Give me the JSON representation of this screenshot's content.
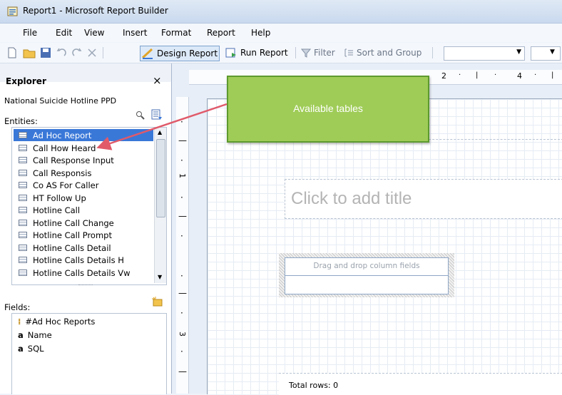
{
  "window": {
    "title": "Report1 - Microsoft Report Builder"
  },
  "menu": [
    "File",
    "Edit",
    "View",
    "Insert",
    "Format",
    "Report",
    "Help"
  ],
  "toolbar": {
    "design_report": "Design Report",
    "run_report": "Run Report",
    "filter": "Filter",
    "sort_group": "Sort and Group"
  },
  "explorer": {
    "title": "Explorer",
    "close": "×",
    "model": "National Suicide Hotline PPD",
    "entities_label": "Entities:",
    "entities": [
      "Ad Hoc Report",
      "Call How Heard",
      "Call Response Input",
      "Call Responsis",
      "Co AS For Caller",
      "HT Follow Up",
      "Hotline Call",
      "Hotline Call Change",
      "Hotline Call Prompt",
      "Hotline Calls Detail",
      "Hotline Calls Details H",
      "Hotline Calls Details Vw"
    ],
    "selected_entity_index": 0,
    "fields_label": "Fields:",
    "fields": [
      {
        "icon": "aggregate-icon",
        "label": "#Ad Hoc Reports"
      },
      {
        "icon": "text-field-icon",
        "label": "Name"
      },
      {
        "icon": "text-field-icon",
        "label": "SQL"
      }
    ]
  },
  "ruler": {
    "h_marks": [
      "2",
      "4"
    ],
    "v_marks": [
      "1",
      "3"
    ]
  },
  "design": {
    "title_placeholder": "Click to add title",
    "table_placeholder": "Drag and drop column fields",
    "total_rows": "Total rows: 0"
  },
  "callout": {
    "text": "Available tables"
  },
  "colors": {
    "selection": "#3a78d8",
    "callout_bg": "#9fcc57",
    "callout_border": "#5d9a2e",
    "arrow": "#e05a6a"
  }
}
